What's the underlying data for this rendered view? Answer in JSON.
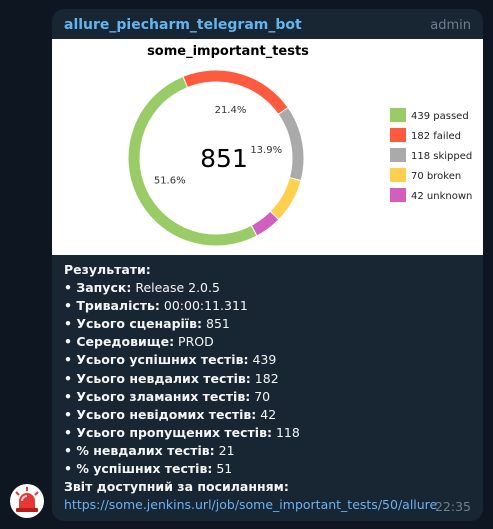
{
  "message": {
    "sender": "allure_piecharm_telegram_bot",
    "role": "admin",
    "time": "22:35",
    "lines": [
      {
        "label": "Результати:",
        "value": ""
      },
      {
        "label": "• Запуск:",
        "value": " Release 2.0.5"
      },
      {
        "label": "• Тривалість:",
        "value": " 00:00:11.311"
      },
      {
        "label": "• Усього сценаріїв:",
        "value": " 851"
      },
      {
        "label": "• Середовище:",
        "value": " PROD"
      },
      {
        "label": "• Усього успішних тестів:",
        "value": " 439"
      },
      {
        "label": "• Усього невдалих тестів:",
        "value": " 182"
      },
      {
        "label": "• Усього зламаних тестів:",
        "value": " 70"
      },
      {
        "label": "• Усього невідомих тестів:",
        "value": " 42"
      },
      {
        "label": "• Усього пропущених тестів:",
        "value": " 118"
      },
      {
        "label": "• % невдалих тестів:",
        "value": " 21"
      },
      {
        "label": "• % успішних тестів:",
        "value": " 51"
      }
    ],
    "report_label": "Звіт доступний за посиланням:",
    "report_link": "https://some.jenkins.url/job/some_important_tests/50/allure"
  },
  "chart_data": {
    "type": "pie",
    "style": "donut",
    "title": "some_important_tests",
    "center_label": "851",
    "slices": [
      {
        "label": "439 passed",
        "value": 439,
        "color": "#99cc66",
        "pct_label": "51.6%"
      },
      {
        "label": "182 failed",
        "value": 182,
        "color": "#fd5a3e",
        "pct_label": "21.4%"
      },
      {
        "label": "118 skipped",
        "value": 118,
        "color": "#aaaaaa",
        "pct_label": "13.9%"
      },
      {
        "label": "70 broken",
        "value": 70,
        "color": "#ffd050",
        "pct_label": ""
      },
      {
        "label": "42 unknown",
        "value": 42,
        "color": "#d35ebe",
        "pct_label": ""
      }
    ],
    "legend_position": "right"
  }
}
